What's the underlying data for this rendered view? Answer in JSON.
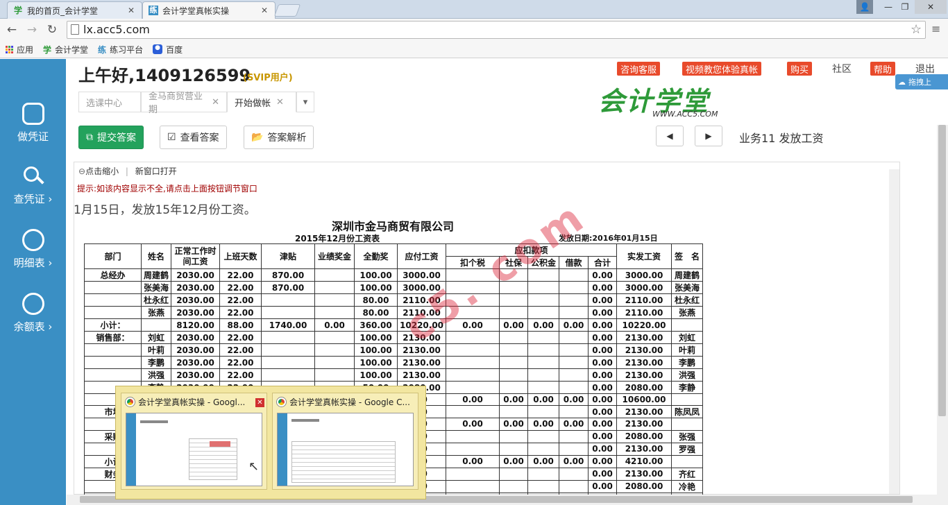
{
  "browser": {
    "tabs": [
      {
        "icon": "学",
        "title": "我的首页_会计学堂"
      },
      {
        "icon": "练",
        "title": "会计学堂真帐实操"
      }
    ],
    "url": "lx.acc5.com",
    "bookmarks": [
      {
        "icon": "apps-icon",
        "label": "应用"
      },
      {
        "icon": "学",
        "label": "会计学堂"
      },
      {
        "icon": "练",
        "label": "练习平台"
      },
      {
        "icon": "paw-icon",
        "label": "百度"
      }
    ]
  },
  "sidebar": {
    "items": [
      {
        "label": "做凭证"
      },
      {
        "label": "查凭证 ›"
      },
      {
        "label": "明细表 ›"
      },
      {
        "label": "余额表 ›"
      }
    ]
  },
  "header": {
    "greeting": "上午好,1409126599",
    "vip": "(SVIP用户)",
    "links": [
      "咨询客服",
      "视频教您体验真帐",
      "购买",
      "社区",
      "帮助",
      "退出"
    ],
    "logo_text": "会计学堂",
    "logo_url": "WWW.ACC5.COM",
    "cloud_label": "拖拽上"
  },
  "content_tabs": [
    "选课中心",
    "金马商贸营业期",
    "开始做帐"
  ],
  "actions": {
    "submit": "提交答案",
    "view": "查看答案",
    "analysis": "答案解析"
  },
  "business_label": "业务11  发放工资",
  "frame": {
    "zoom": "点击缩小",
    "new_window": "新窗口打开",
    "hint": "提示:如该内容显示不全,请点击上面按钮调节窗口"
  },
  "task": "1月15日，发放15年12月份工资。",
  "document": {
    "company": "深圳市金马商贸有限公司",
    "title": "2015年12月份工资表",
    "issue_date": "发放日期:2016年01月15日",
    "headers": [
      "部门",
      "姓名",
      "正常工作时间工资",
      "上班天数",
      "津贴",
      "业绩奖金",
      "全勤奖",
      "应付工资",
      "应扣款项",
      "实发工资",
      "签　名"
    ],
    "subheaders": [
      "扣个税",
      "社保",
      "公积金",
      "借款",
      "合计"
    ],
    "rows": [
      [
        "总经办",
        "周建鹤",
        "2030.00",
        "22.00",
        "870.00",
        "",
        "100.00",
        "3000.00",
        "",
        "",
        "",
        "",
        "0.00",
        "3000.00",
        "周建鹤"
      ],
      [
        "",
        "张美海",
        "2030.00",
        "22.00",
        "870.00",
        "",
        "100.00",
        "3000.00",
        "",
        "",
        "",
        "",
        "0.00",
        "3000.00",
        "张美海"
      ],
      [
        "",
        "杜永红",
        "2030.00",
        "22.00",
        "",
        "",
        "80.00",
        "2110.00",
        "",
        "",
        "",
        "",
        "0.00",
        "2110.00",
        "杜永红"
      ],
      [
        "",
        "张燕",
        "2030.00",
        "22.00",
        "",
        "",
        "80.00",
        "2110.00",
        "",
        "",
        "",
        "",
        "0.00",
        "2110.00",
        "张燕"
      ],
      [
        "小计：",
        "",
        "8120.00",
        "88.00",
        "1740.00",
        "0.00",
        "360.00",
        "10220.00",
        "0.00",
        "0.00",
        "0.00",
        "0.00",
        "0.00",
        "10220.00",
        ""
      ],
      [
        "销售部：",
        "刘虹",
        "2030.00",
        "22.00",
        "",
        "",
        "100.00",
        "2130.00",
        "",
        "",
        "",
        "",
        "0.00",
        "2130.00",
        "刘虹"
      ],
      [
        "",
        "叶莉",
        "2030.00",
        "22.00",
        "",
        "",
        "100.00",
        "2130.00",
        "",
        "",
        "",
        "",
        "0.00",
        "2130.00",
        "叶莉"
      ],
      [
        "",
        "李鹏",
        "2030.00",
        "22.00",
        "",
        "",
        "100.00",
        "2130.00",
        "",
        "",
        "",
        "",
        "0.00",
        "2130.00",
        "李鹏"
      ],
      [
        "",
        "洪强",
        "2030.00",
        "22.00",
        "",
        "",
        "100.00",
        "2130.00",
        "",
        "",
        "",
        "",
        "0.00",
        "2130.00",
        "洪强"
      ],
      [
        "",
        "李静",
        "2030.00",
        "22.00",
        "",
        "",
        "50.00",
        "2080.00",
        "",
        "",
        "",
        "",
        "0.00",
        "2080.00",
        "李静"
      ],
      [
        "",
        "",
        "",
        "",
        "",
        "",
        "",
        "00",
        "0.00",
        "0.00",
        "0.00",
        "0.00",
        "0.00",
        "10600.00",
        ""
      ],
      [
        "市场",
        "",
        "",
        "",
        "",
        "",
        "",
        "00",
        "",
        "",
        "",
        "",
        "0.00",
        "2130.00",
        "陈凤凤"
      ],
      [
        "",
        "",
        "",
        "",
        "",
        "",
        "",
        "00",
        "0.00",
        "0.00",
        "0.00",
        "0.00",
        "0.00",
        "2130.00",
        ""
      ],
      [
        "采购",
        "",
        "",
        "",
        "",
        "",
        "",
        "00",
        "",
        "",
        "",
        "",
        "0.00",
        "2080.00",
        "张强"
      ],
      [
        "",
        "",
        "",
        "",
        "",
        "",
        "",
        "00",
        "",
        "",
        "",
        "",
        "0.00",
        "2130.00",
        "罗强"
      ],
      [
        "小计",
        "",
        "",
        "",
        "",
        "",
        "",
        "00",
        "0.00",
        "0.00",
        "0.00",
        "0.00",
        "0.00",
        "4210.00",
        ""
      ],
      [
        "财务",
        "",
        "",
        "",
        "",
        "",
        "",
        "00",
        "",
        "",
        "",
        "",
        "0.00",
        "2130.00",
        "齐红"
      ],
      [
        "",
        "",
        "",
        "",
        "",
        "",
        "",
        "00",
        "",
        "",
        "",
        "",
        "0.00",
        "2080.00",
        "冷艳"
      ],
      [
        "",
        "",
        "",
        "",
        "",
        "",
        "",
        "00",
        "0.00",
        "0.00",
        "0.00",
        "0.00",
        "0.00",
        "4210.00",
        ""
      ]
    ],
    "watermark": "c5. com"
  },
  "taskbar_preview": [
    {
      "title": "会计学堂真帐实操 - Googl..."
    },
    {
      "title": "会计学堂真帐实操 - Google C..."
    }
  ]
}
